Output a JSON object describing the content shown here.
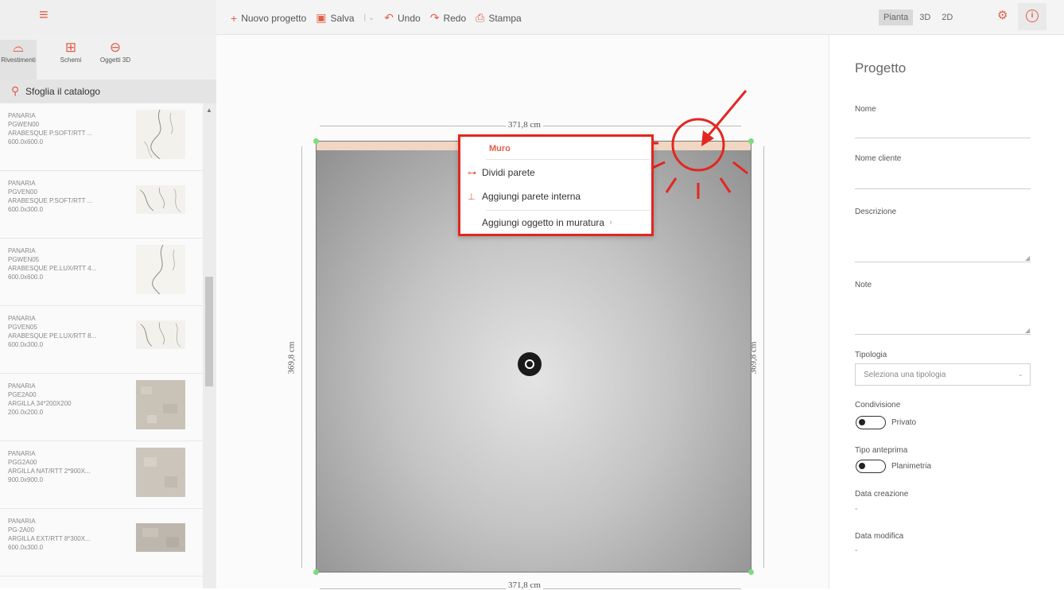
{
  "toolbar": {
    "new_project": "Nuovo progetto",
    "save": "Salva",
    "undo": "Undo",
    "redo": "Redo",
    "print": "Stampa"
  },
  "view_tabs": [
    "Pianta",
    "3D",
    "2D"
  ],
  "active_view": "Pianta",
  "catalog_tabs": [
    {
      "label": "Rivestimenti",
      "icon": "tile-icon"
    },
    {
      "label": "Schemi",
      "icon": "grid-icon"
    },
    {
      "label": "Oggetti 3D",
      "icon": "object-icon"
    }
  ],
  "search_label": "Sfoglia il catalogo",
  "products": [
    {
      "brand": "PANARIA",
      "code": "PGWEN00",
      "name": "ARABESQUE P.SOFT/RTT ...",
      "size": "600.0x600.0",
      "swatch": "marble"
    },
    {
      "brand": "PANARIA",
      "code": "PGVEN00",
      "name": "ARABESQUE P.SOFT/RTT ...",
      "size": "600.0x300.0",
      "swatch": "marble"
    },
    {
      "brand": "PANARIA",
      "code": "PGWEN05",
      "name": "ARABESQUE PE.LUX/RTT 4...",
      "size": "600.0x600.0",
      "swatch": "marble"
    },
    {
      "brand": "PANARIA",
      "code": "PGVEN05",
      "name": "ARABESQUE PE.LUX/RTT 8...",
      "size": "600.0x300.0",
      "swatch": "marble"
    },
    {
      "brand": "PANARIA",
      "code": "PGE2A00",
      "name": "ARGILLA 34*200X200",
      "size": "200.0x200.0",
      "swatch": "stone"
    },
    {
      "brand": "PANARIA",
      "code": "PGG2A00",
      "name": "ARGILLA NAT/RTT 2*900X...",
      "size": "900.0x900.0",
      "swatch": "stone"
    },
    {
      "brand": "PANARIA",
      "code": "PG-2A00",
      "name": "ARGILLA EXT/RTT 8*300X...",
      "size": "600.0x300.0",
      "swatch": "stone"
    }
  ],
  "dimensions": {
    "width": "371,8 cm",
    "height": "369,8 cm"
  },
  "context_menu": {
    "title": "Muro",
    "items": [
      {
        "label": "Dividi parete",
        "icon": "split-wall-icon"
      },
      {
        "label": "Aggiungi parete interna",
        "icon": "inner-wall-icon"
      },
      {
        "label": "Aggiungi oggetto in muratura",
        "icon": "chevron-right-icon"
      }
    ]
  },
  "project": {
    "title": "Progetto",
    "name_label": "Nome",
    "client_label": "Nome cliente",
    "description_label": "Descrizione",
    "notes_label": "Note",
    "type_label": "Tipologia",
    "type_placeholder": "Seleziona una tipologia",
    "sharing_label": "Condivisione",
    "sharing_value": "Privato",
    "preview_label": "Tipo anteprima",
    "preview_value": "Planimetria",
    "created_label": "Data creazione",
    "created_value": "-",
    "modified_label": "Data modifica",
    "modified_value": "-"
  },
  "colors": {
    "accent": "#e0604a",
    "highlight": "#e32620"
  }
}
